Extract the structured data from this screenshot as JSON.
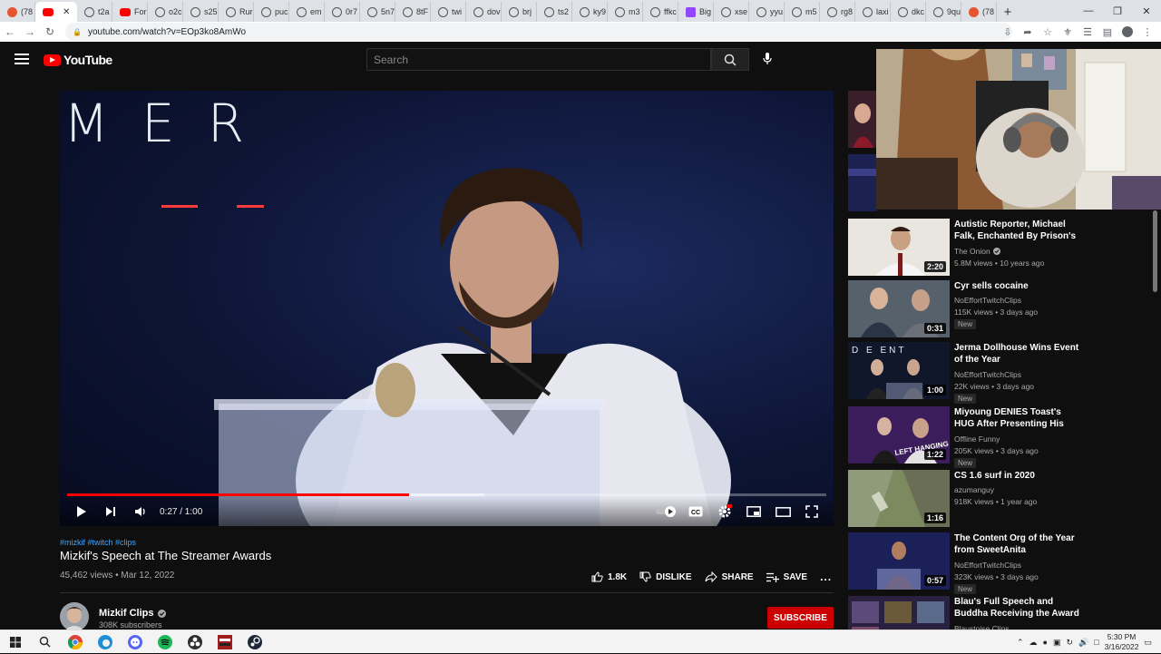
{
  "browser": {
    "tabs": [
      {
        "label": "(78",
        "icon": "firefox-red-icon"
      },
      {
        "label": "",
        "icon": "youtube-icon",
        "active": true
      },
      {
        "label": "t2a",
        "icon": "globe-icon"
      },
      {
        "label": "For",
        "icon": "youtube-icon"
      },
      {
        "label": "o2c",
        "icon": "globe-icon"
      },
      {
        "label": "s25",
        "icon": "globe-icon"
      },
      {
        "label": "Rur",
        "icon": "globe-icon"
      },
      {
        "label": "puc",
        "icon": "globe-icon"
      },
      {
        "label": "em",
        "icon": "globe-icon"
      },
      {
        "label": "0r7",
        "icon": "globe-icon"
      },
      {
        "label": "5n7",
        "icon": "globe-icon"
      },
      {
        "label": "8tF",
        "icon": "globe-icon"
      },
      {
        "label": "twi",
        "icon": "globe-icon"
      },
      {
        "label": "dov",
        "icon": "globe-icon"
      },
      {
        "label": "brj",
        "icon": "globe-icon"
      },
      {
        "label": "ts2",
        "icon": "globe-icon"
      },
      {
        "label": "ky9",
        "icon": "globe-icon"
      },
      {
        "label": "m3",
        "icon": "globe-icon"
      },
      {
        "label": "ffkc",
        "icon": "globe-icon"
      },
      {
        "label": "Big",
        "icon": "twitch-icon"
      },
      {
        "label": "xse",
        "icon": "globe-icon"
      },
      {
        "label": "yyu",
        "icon": "globe-icon"
      },
      {
        "label": "m5",
        "icon": "globe-icon"
      },
      {
        "label": "rg8",
        "icon": "globe-icon"
      },
      {
        "label": "laxi",
        "icon": "globe-icon"
      },
      {
        "label": "dkc",
        "icon": "globe-icon"
      },
      {
        "label": "9qu",
        "icon": "globe-icon"
      },
      {
        "label": "(78",
        "icon": "firefox-red-icon"
      }
    ],
    "url": "youtube.com/watch?v=EOp3ko8AmWo",
    "new_tab": "+"
  },
  "header": {
    "logo_text": "YouTube",
    "search_placeholder": "Search"
  },
  "player": {
    "stage_text": "MER",
    "timecode": "0:27 / 1:00",
    "progress_played": 0.45,
    "progress_buffered": 0.55
  },
  "video": {
    "hashtags": "#mizkif #twitch #clips",
    "title": "Mizkif's Speech at The Streamer Awards",
    "meta": "45,462 views • Mar 12, 2022",
    "actions": {
      "like": "1.8K",
      "dislike": "DISLIKE",
      "share": "SHARE",
      "save": "SAVE",
      "more": "..."
    }
  },
  "channel": {
    "name": "Mizkif Clips",
    "subs": "308K subscribers",
    "subscribe": "SUBSCRIBE"
  },
  "recommendations": [
    {
      "title": "Autistic Reporter, Michael Falk, Enchanted By Prison's Rigid…",
      "channel": "The Onion",
      "verified": true,
      "stats": "5.8M views • 10 years ago",
      "duration": "2:20",
      "badge": ""
    },
    {
      "title": "Cyr sells cocaine",
      "channel": "NoEffortTwitchClips",
      "verified": false,
      "stats": "115K views • 3 days ago",
      "duration": "0:31",
      "badge": "New"
    },
    {
      "title": "Jerma Dollhouse Wins Event of the Year",
      "channel": "NoEffortTwitchClips",
      "verified": false,
      "stats": "22K views • 3 days ago",
      "duration": "1:00",
      "badge": "New"
    },
    {
      "title": "Miyoung DENIES Toast's HUG After Presenting His Award At…",
      "channel": "Offline Funny",
      "verified": false,
      "stats": "205K views • 3 days ago",
      "duration": "1:22",
      "badge": "New"
    },
    {
      "title": "CS 1.6 surf in 2020",
      "channel": "azumanguy",
      "verified": false,
      "stats": "918K views • 1 year ago",
      "duration": "1:16",
      "badge": ""
    },
    {
      "title": "The Content Org of the Year from SweetAnita",
      "channel": "NoEffortTwitchClips",
      "verified": false,
      "stats": "323K views • 3 days ago",
      "duration": "0:57",
      "badge": "New"
    },
    {
      "title": "Blau's Full Speech and Buddha Receiving the Award for the…",
      "channel": "Blaustoise Clips",
      "verified": false,
      "stats": "",
      "duration": "",
      "badge": ""
    }
  ],
  "thumb_texts": {
    "jerma": "D E ENT",
    "miyoung": "LEFT HANGING"
  },
  "taskbar": {
    "time": "5:30 PM",
    "date": "3/16/2022",
    "app_icons": [
      "windows-start-icon",
      "search-icon",
      "chrome-icon",
      "edge-icon",
      "discord-icon",
      "spotify-icon",
      "obs-icon",
      "app-icon",
      "steam-icon"
    ]
  },
  "colors": {
    "accent_red": "#ff0000",
    "subscribe_bg": "#cc0000",
    "link_blue": "#3ea6ff",
    "bg": "#0f0f0f"
  }
}
